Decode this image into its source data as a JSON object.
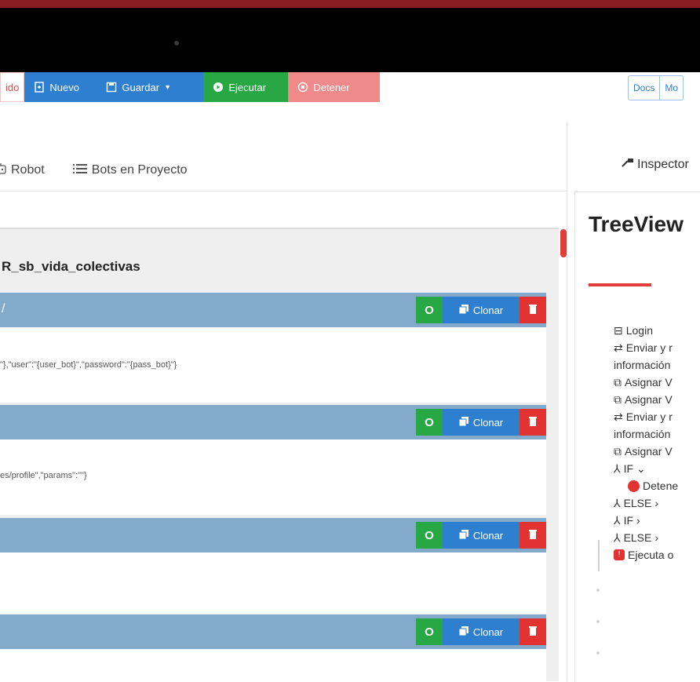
{
  "toolbar": {
    "fragment_label": "ido",
    "nuevo": "Nuevo",
    "guardar": "Guardar",
    "ejecutar": "Ejecutar",
    "detener": "Detener"
  },
  "right_links": {
    "docs": "Docs",
    "more": "Mo"
  },
  "tabs": {
    "robot": "Robot",
    "bots": "Bots en Proyecto"
  },
  "project": {
    "title": "R_sb_vida_colectivas"
  },
  "steps": [
    {
      "label": "/",
      "code": "\"},\"user\":\"{user_bot}\",\"password\":\"{pass_bot}\"}"
    },
    {
      "label": "",
      "code": "es/profile\",\"params\":\"\"}"
    },
    {
      "label": "",
      "code": ""
    },
    {
      "label": "",
      "code": ""
    }
  ],
  "step_actions": {
    "clone": "Clonar"
  },
  "inspector": {
    "tab": "Inspector",
    "title": "TreeView"
  },
  "tree": {
    "login": "Login",
    "enviar1": "Enviar y r",
    "informacion1": "información",
    "asignar1": "Asignar V",
    "asignar2": "Asignar V",
    "enviar2": "Enviar y r",
    "informacion2": "información",
    "asignar3": "Asignar V",
    "if1": "IF",
    "detener": "Detene",
    "else1": "ELSE",
    "if2": "IF",
    "else2": "ELSE",
    "ejecuta": "Ejecuta o"
  },
  "colors": {
    "primary": "#2f7fd0",
    "success": "#28a745",
    "danger": "#e23232",
    "step_header": "#83a9cb",
    "accent": "#e43b3b"
  },
  "icons": [
    "new-file-icon",
    "save-icon",
    "caret-down-icon",
    "play-icon",
    "stop-icon",
    "robot-icon",
    "list-icon",
    "inspector-icon",
    "clone-icon",
    "trash-icon",
    "sitemap-icon"
  ]
}
